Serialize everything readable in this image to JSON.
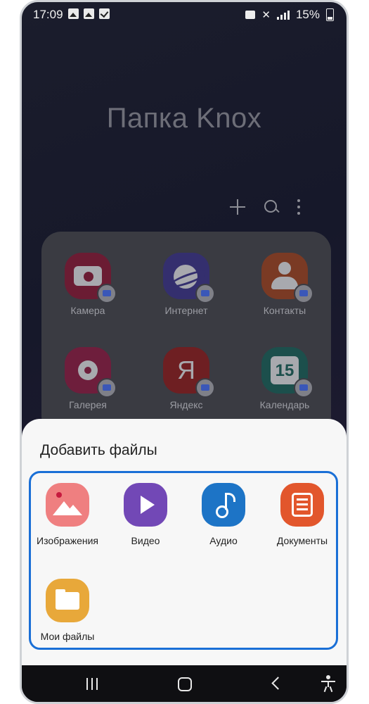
{
  "status_bar": {
    "time": "17:09",
    "battery": "15%"
  },
  "background": {
    "title": "Папка Knox",
    "apps": [
      {
        "label": "Камера",
        "icon": "camera-icon",
        "color": "#d6245a"
      },
      {
        "label": "Интернет",
        "icon": "internet-icon",
        "color": "#5b4fc8"
      },
      {
        "label": "Контакты",
        "icon": "contacts-icon",
        "color": "#e25f36"
      },
      {
        "label": "Галерея",
        "icon": "gallery-icon",
        "color": "#d62d64"
      },
      {
        "label": "Яндекс",
        "icon": "yandex-icon",
        "color": "#d9262d"
      },
      {
        "label": "Календарь",
        "icon": "calendar-icon",
        "color": "#1fa59a"
      }
    ],
    "calendar_day": "15",
    "yandex_letter": "Я"
  },
  "sheet": {
    "title": "Добавить файлы",
    "options": [
      {
        "label": "Изображения",
        "icon": "pictures-icon",
        "color": "#ef7f80"
      },
      {
        "label": "Видео",
        "icon": "video-icon",
        "color": "#7248b6"
      },
      {
        "label": "Аудио",
        "icon": "audio-icon",
        "color": "#1d74c6"
      },
      {
        "label": "Документы",
        "icon": "documents-icon",
        "color": "#e2562c"
      },
      {
        "label": "Мои файлы",
        "icon": "my-files-icon",
        "color": "#e8a83a"
      }
    ],
    "highlight_color": "#1a6fd6"
  }
}
